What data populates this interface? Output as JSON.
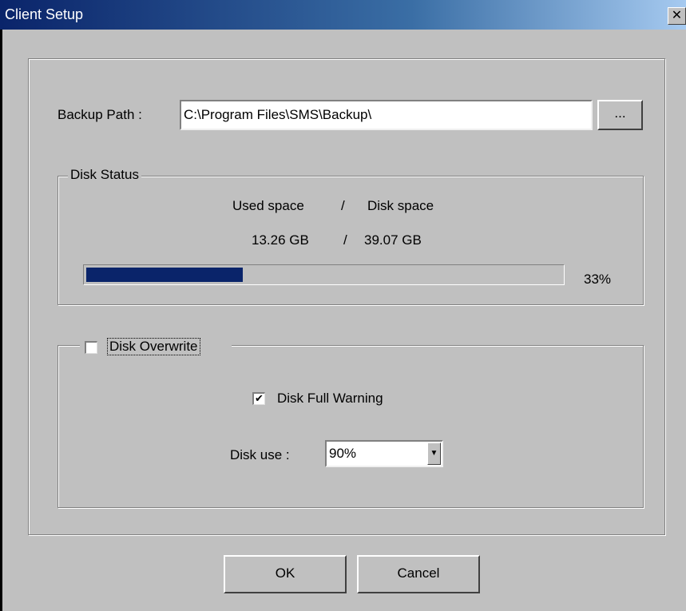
{
  "window": {
    "title": "Client Setup",
    "close_glyph": "✕"
  },
  "backup": {
    "label": "Backup Path :",
    "path": "C:\\Program Files\\SMS\\Backup\\",
    "browse_label": "..."
  },
  "disk_status": {
    "title": "Disk Status",
    "header_used": "Used space",
    "header_sep": "/",
    "header_disk": "Disk space",
    "used_value": "13.26 GB",
    "value_sep": "/",
    "disk_value": "39.07 GB",
    "percent_label": "33%",
    "progress_fraction": 0.33
  },
  "overwrite": {
    "label": "Disk Overwrite",
    "checked": false
  },
  "warning": {
    "label": "Disk Full Warning",
    "checked": true,
    "check_glyph": "✔"
  },
  "disk_use": {
    "label": "Disk use :",
    "selected": "90%",
    "arrow_glyph": "▼"
  },
  "buttons": {
    "ok": "OK",
    "cancel": "Cancel"
  },
  "colors": {
    "titlebar_start": "#0a246a",
    "titlebar_end": "#a6caf0",
    "progress_fill": "#0a246a",
    "face": "#c0c0c0"
  }
}
